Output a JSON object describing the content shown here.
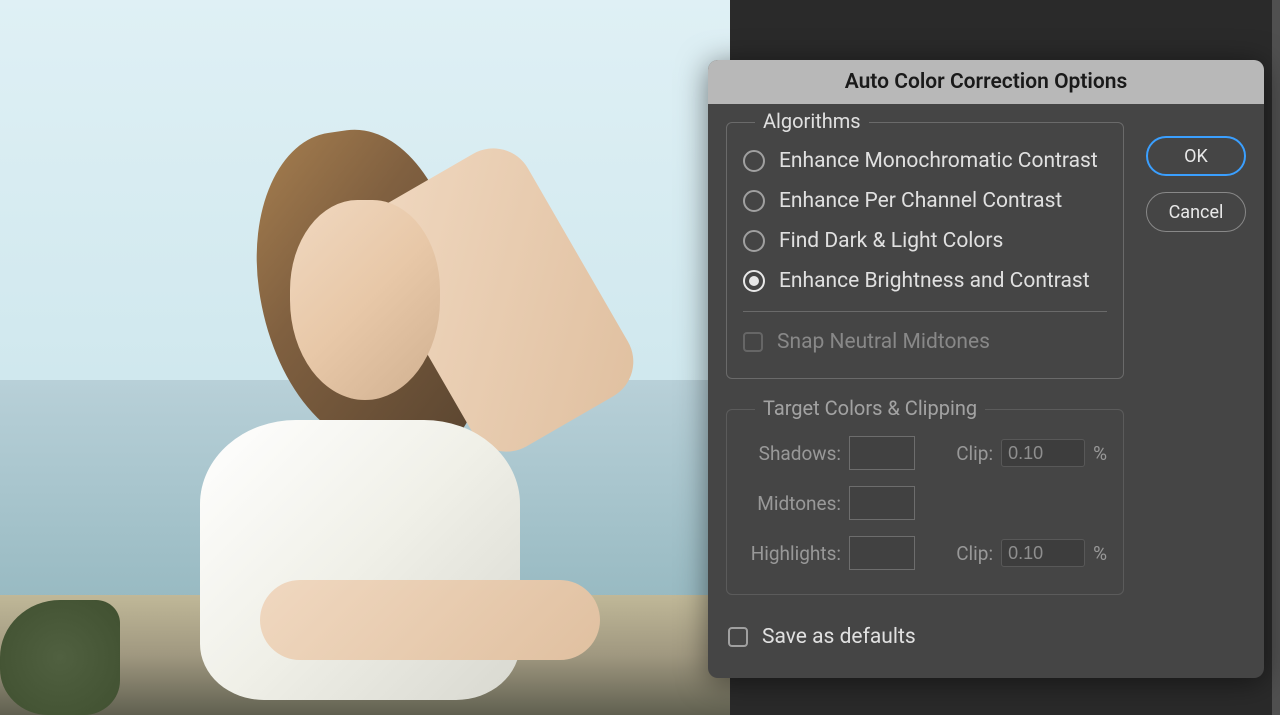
{
  "dialog": {
    "title": "Auto Color Correction Options",
    "buttons": {
      "ok": "OK",
      "cancel": "Cancel"
    },
    "algorithms": {
      "legend": "Algorithms",
      "options": [
        {
          "label": "Enhance Monochromatic Contrast",
          "selected": false
        },
        {
          "label": "Enhance Per Channel Contrast",
          "selected": false
        },
        {
          "label": "Find Dark & Light Colors",
          "selected": false
        },
        {
          "label": "Enhance Brightness and Contrast",
          "selected": true
        }
      ],
      "snapNeutral": {
        "label": "Snap Neutral Midtones",
        "enabled": false,
        "checked": false
      }
    },
    "targetColors": {
      "legend": "Target Colors & Clipping",
      "rows": [
        {
          "label": "Shadows:",
          "clipLabel": "Clip:",
          "clipValue": "0.10",
          "percent": "%",
          "hasClip": true
        },
        {
          "label": "Midtones:",
          "hasClip": false
        },
        {
          "label": "Highlights:",
          "clipLabel": "Clip:",
          "clipValue": "0.10",
          "percent": "%",
          "hasClip": true
        }
      ]
    },
    "saveDefaults": {
      "label": "Save as defaults",
      "checked": false
    }
  }
}
